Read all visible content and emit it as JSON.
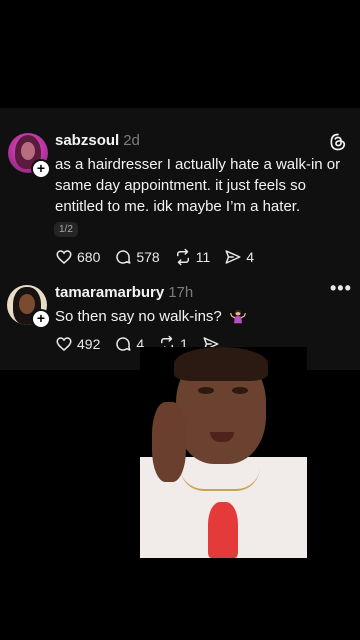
{
  "posts": [
    {
      "username": "sabzsoul",
      "time": "2d",
      "text": "as a hairdresser I actually hate a walk-in or same day appointment. it just feels so entitled to me. idk maybe I’m a hater.",
      "page_indicator": "1/2",
      "likes": "680",
      "replies": "578",
      "reposts": "11",
      "shares": "4"
    },
    {
      "username": "tamaramarbury",
      "time": "17h",
      "text": "So then say no walk-ins?",
      "emoji_icon": "woman-shrugging-emoji",
      "likes": "492",
      "replies": "4",
      "reposts": "1",
      "shares": ""
    }
  ],
  "icons": {
    "threads_logo": "threads-logo-icon",
    "more_menu": "more-horizontal-icon"
  },
  "colors": {
    "background": "#000000",
    "card": "#101010",
    "text_primary": "#f3f3f3",
    "text_muted": "#7c7c7c"
  }
}
